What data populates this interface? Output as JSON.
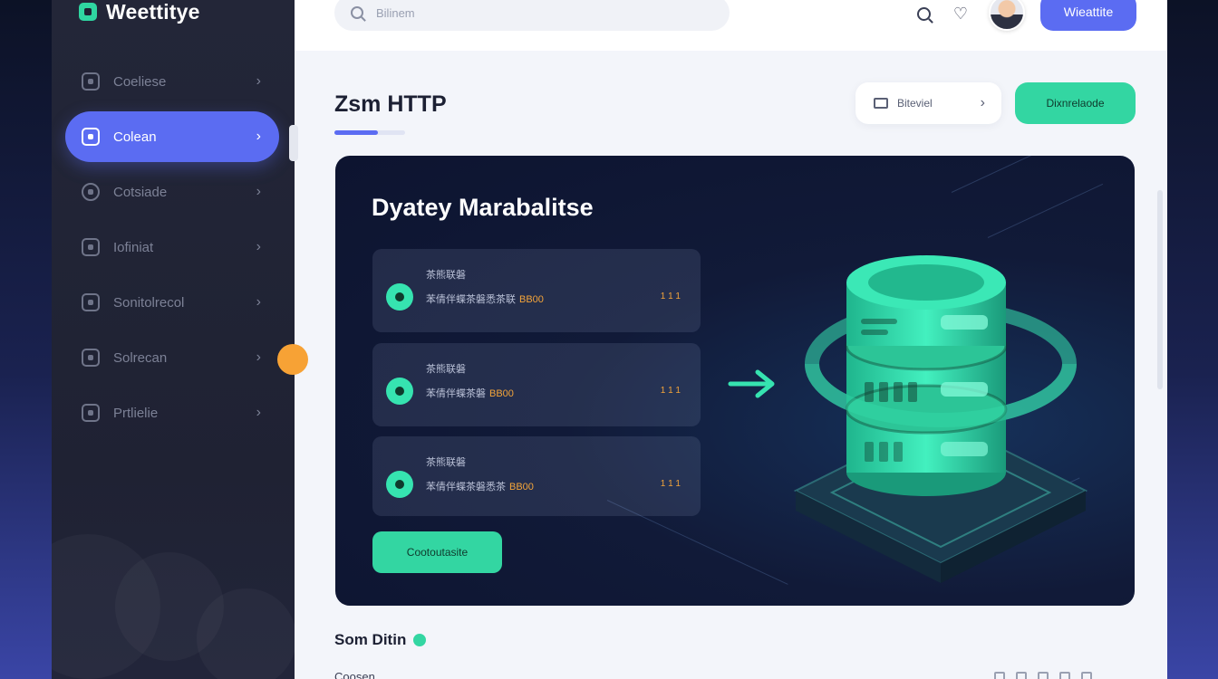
{
  "brand": {
    "name": "Weettitye"
  },
  "topbar": {
    "search_placeholder": "Bilinem",
    "primary_button": "Wieattite"
  },
  "sidebar": {
    "items": [
      {
        "label": "Coeliese",
        "active": false,
        "icon": "settings-icon"
      },
      {
        "label": "Colean",
        "active": true,
        "icon": "database-icon"
      },
      {
        "label": "Cotsiade",
        "active": false,
        "icon": "globe-icon"
      },
      {
        "label": "Iofiniat",
        "active": false,
        "icon": "folder-icon"
      },
      {
        "label": "Sonitolrecol",
        "active": false,
        "icon": "document-icon"
      },
      {
        "label": "Solrecan",
        "active": false,
        "icon": "terminal-icon"
      },
      {
        "label": "Prtlielie",
        "active": false,
        "icon": "users-icon"
      }
    ]
  },
  "header": {
    "title": "Zsm HTTP",
    "secondary_button": "Biteviel",
    "primary_button": "Dixnrelaode"
  },
  "hero": {
    "title": "Dyatey Marabalitse",
    "steps": [
      {
        "head": "茶熊联磐",
        "body": "苯倩伴蝶茶磐悉茶联",
        "value": "BB00",
        "tag": "1 1 1"
      },
      {
        "head": "茶熊联磐",
        "body": "苯倩伴蝶茶磐",
        "value": "BB00",
        "tag": "1 1 1"
      },
      {
        "head": "茶熊联磐",
        "body": "苯倩伴蝶茶磐悉茶",
        "value": "BB00",
        "tag": "1 1 1"
      }
    ],
    "button": "Cootoutasite"
  },
  "section": {
    "title": "Som Ditin",
    "row_label": "Coosen"
  },
  "colors": {
    "accent": "#5b6cf2",
    "green": "#33d6a2",
    "orange": "#f7a235",
    "sidebar_bg": "#1f2233",
    "hero_bg": "#0d1430"
  }
}
